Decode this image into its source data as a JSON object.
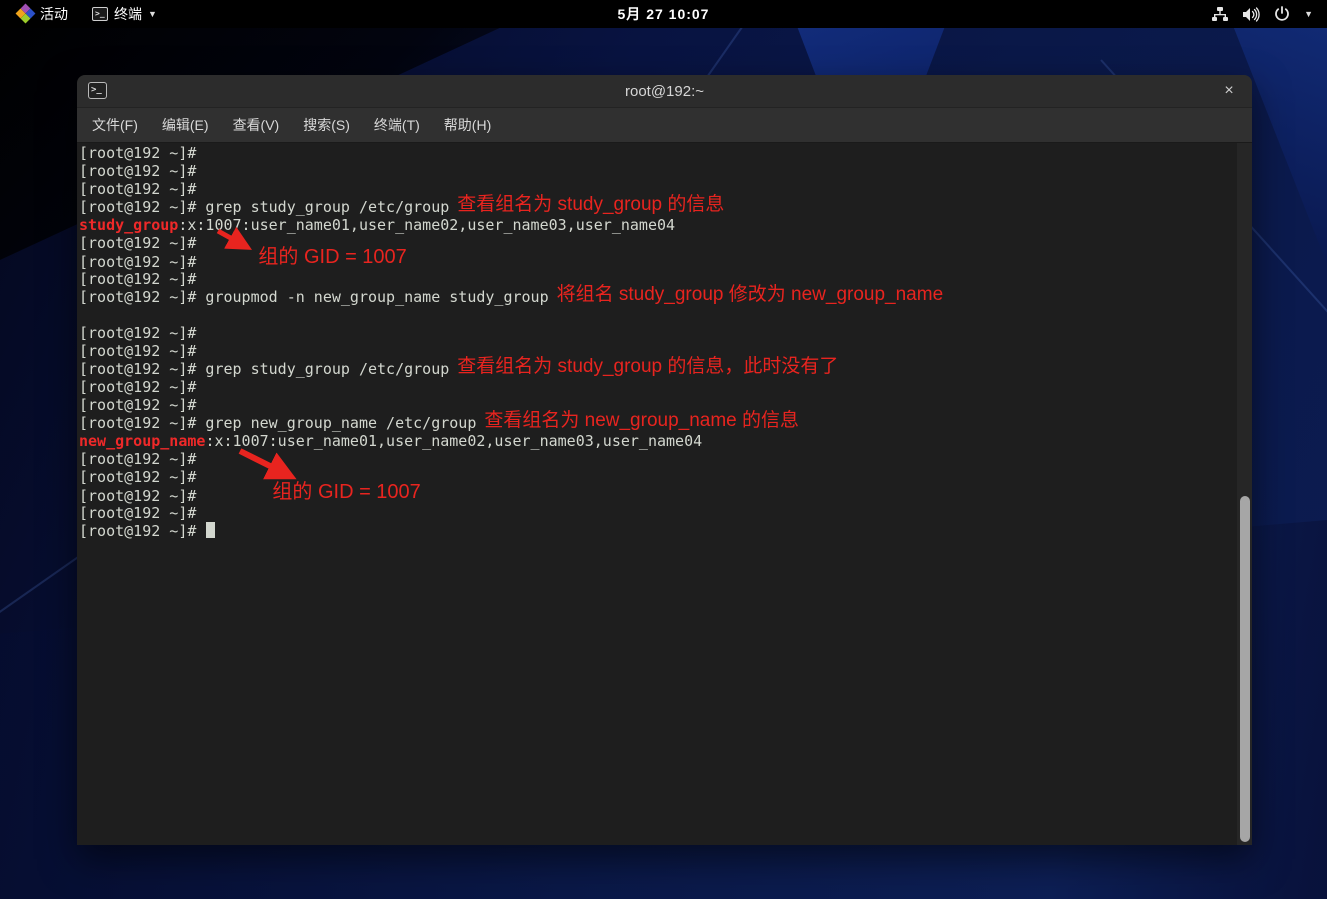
{
  "topbar": {
    "activities_label": "活动",
    "app_menu_label": "终端",
    "clock": "5月 27 10:07",
    "icons": [
      "centos-logo-icon",
      "terminal-app-icon",
      "network-icon",
      "volume-icon",
      "power-icon",
      "chevron-down-icon"
    ]
  },
  "window": {
    "title": "root@192:~",
    "close_label": "×",
    "menus": [
      {
        "name": "menu-file",
        "label": "文件(F)"
      },
      {
        "name": "menu-edit",
        "label": "编辑(E)"
      },
      {
        "name": "menu-view",
        "label": "查看(V)"
      },
      {
        "name": "menu-search",
        "label": "搜索(S)"
      },
      {
        "name": "menu-terminal",
        "label": "终端(T)"
      },
      {
        "name": "menu-help",
        "label": "帮助(H)"
      }
    ]
  },
  "colors": {
    "annotation_red": "#e8241f",
    "grep_match_red": "#ef2929",
    "terminal_foreground": "#d3d7cf",
    "terminal_background": "#1e1e1e"
  },
  "terminal": {
    "prompt": "[root@192 ~]#",
    "lines": [
      [
        {
          "t": "p",
          "x": "[root@192 ~]#"
        }
      ],
      [
        {
          "t": "p",
          "x": "[root@192 ~]#"
        }
      ],
      [
        {
          "t": "p",
          "x": "[root@192 ~]#"
        }
      ],
      [
        {
          "t": "p",
          "x": "[root@192 ~]# grep study_group /etc/group"
        },
        {
          "t": "a",
          "x": "查看组名为 study_group 的信息"
        }
      ],
      [
        {
          "t": "m",
          "x": "study_group"
        },
        {
          "t": "p",
          "x": ":x:1007:user_name01,user_name02,user_name03,user_name04"
        }
      ],
      [
        {
          "t": "p",
          "x": "[root@192 ~]#"
        }
      ],
      [
        {
          "t": "p",
          "x": "[root@192 ~]#"
        },
        {
          "t": "g",
          "x": "组的 GID = 1007"
        }
      ],
      [
        {
          "t": "p",
          "x": "[root@192 ~]#"
        }
      ],
      [
        {
          "t": "p",
          "x": "[root@192 ~]# groupmod -n new_group_name study_group"
        },
        {
          "t": "a",
          "x": "将组名 study_group 修改为 new_group_name"
        }
      ],
      [],
      [
        {
          "t": "p",
          "x": "[root@192 ~]#"
        }
      ],
      [
        {
          "t": "p",
          "x": "[root@192 ~]#"
        }
      ],
      [
        {
          "t": "p",
          "x": "[root@192 ~]# grep study_group /etc/group"
        },
        {
          "t": "a",
          "x": "查看组名为 study_group 的信息，此时没有了"
        }
      ],
      [
        {
          "t": "p",
          "x": "[root@192 ~]#"
        }
      ],
      [
        {
          "t": "p",
          "x": "[root@192 ~]#"
        }
      ],
      [
        {
          "t": "p",
          "x": "[root@192 ~]# grep new_group_name /etc/group"
        },
        {
          "t": "a",
          "x": "查看组名为 new_group_name 的信息"
        }
      ],
      [
        {
          "t": "m",
          "x": "new_group_name"
        },
        {
          "t": "p",
          "x": ":x:1007:user_name01,user_name02,user_name03,user_name04"
        }
      ],
      [
        {
          "t": "p",
          "x": "[root@192 ~]#"
        }
      ],
      [
        {
          "t": "p",
          "x": "[root@192 ~]#"
        }
      ],
      [
        {
          "t": "p",
          "x": "[root@192 ~]#"
        },
        {
          "t": "g2",
          "x": "组的 GID = 1007"
        }
      ],
      [
        {
          "t": "p",
          "x": "[root@192 ~]#"
        }
      ],
      [
        {
          "t": "p",
          "x": "[root@192 ~]# "
        },
        {
          "t": "cursor"
        }
      ]
    ]
  }
}
